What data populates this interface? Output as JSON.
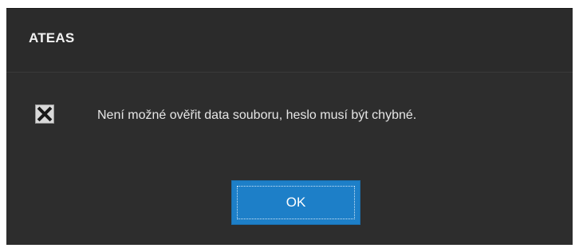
{
  "dialog": {
    "title": "ATEAS",
    "message": "Není možné ověřit data souboru, heslo musí být chybné.",
    "icon": "error-x-icon",
    "ok_label": "OK"
  },
  "colors": {
    "dialog_background": "#2d2d2d",
    "title_text": "#f2f2f2",
    "message_text": "#e6e6e6",
    "button_background": "#1d7fc8",
    "button_text": "#ffffff",
    "icon_background": "#d9d9d9",
    "icon_glyph": "#1a1a1a"
  }
}
